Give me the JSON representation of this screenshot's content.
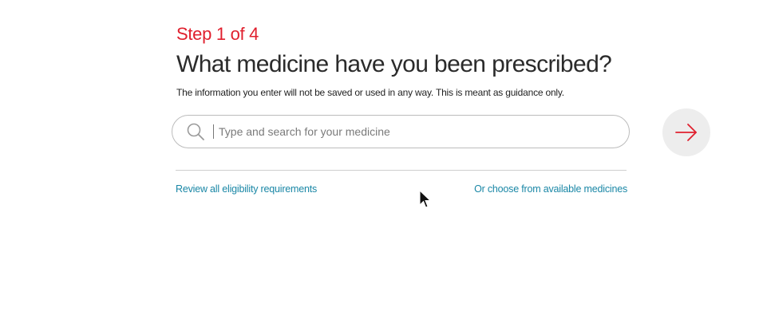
{
  "step": {
    "label": "Step 1 of 4"
  },
  "heading": {
    "title": "What medicine have you been prescribed?",
    "subtitle": "The information you enter will not be saved or used in any way. This is meant as guidance only."
  },
  "search": {
    "placeholder": "Type and search for your medicine",
    "value": "",
    "icon": "search-icon"
  },
  "submit": {
    "icon": "arrow-right-icon",
    "accent_color": "#e0202e"
  },
  "links": {
    "review": "Review all eligibility requirements",
    "choose": "Or choose from available medicines"
  },
  "colors": {
    "step": "#e0202e",
    "link": "#1a87a6",
    "title": "#2b2b2b"
  }
}
